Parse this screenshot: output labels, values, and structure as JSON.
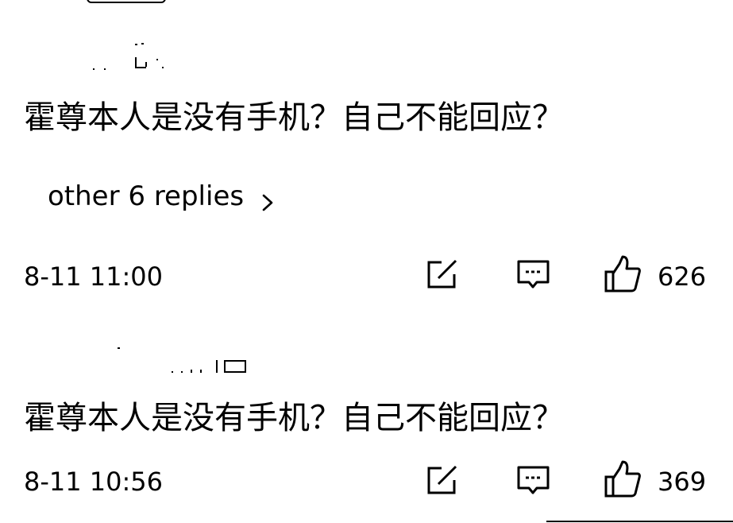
{
  "comments": [
    {
      "text": "霍尊本人是没有手机？自己不能回应？",
      "replies_link": "other 6 replies",
      "timestamp": "8-11 11:00",
      "likes": "626"
    },
    {
      "text": "霍尊本人是没有手机？自己不能回应？",
      "timestamp": "8-11 10:56",
      "likes": "369"
    }
  ],
  "icons": {
    "edit": "edit-icon",
    "comment": "comment-icon",
    "like": "thumbs-up-icon",
    "chevron": "chevron-right-icon"
  },
  "colors": {
    "text": "#000000",
    "background": "#ffffff"
  }
}
